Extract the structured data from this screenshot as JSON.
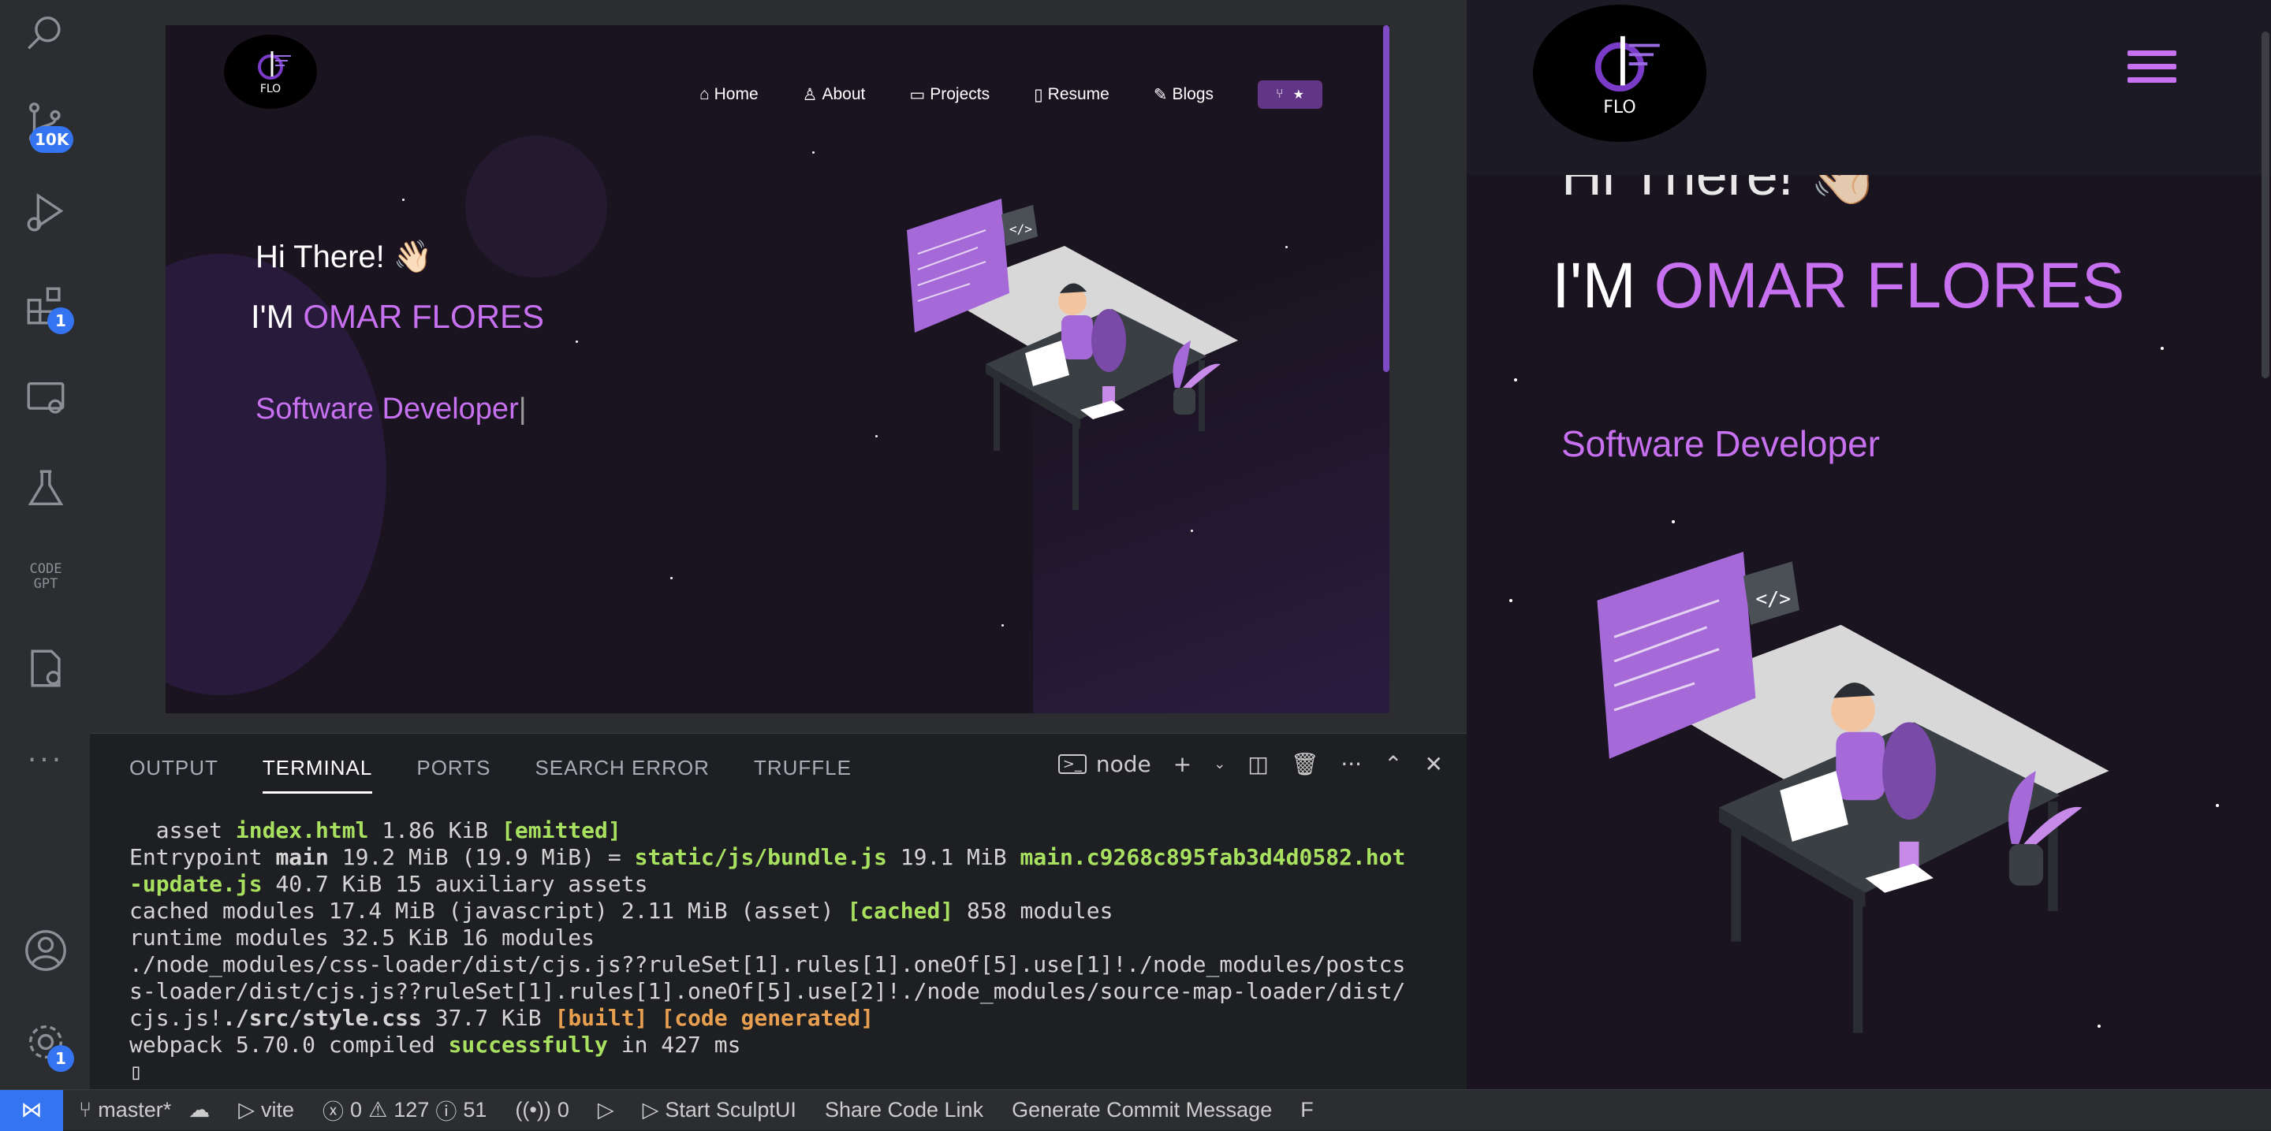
{
  "activity": {
    "scm_badge": "10K",
    "ext_badge": "1",
    "settings_badge": "1",
    "icons": [
      "search-icon",
      "source-control-icon",
      "run-debug-icon",
      "extensions-icon",
      "remote-explorer-icon",
      "testing-icon",
      "codegpt-icon",
      "docker-icon",
      "more-icon",
      "account-icon",
      "settings-icon"
    ],
    "codegpt_text_1": "CODE",
    "codegpt_text_2": "GPT"
  },
  "site": {
    "logo_text": "FLO",
    "nav": [
      "Home",
      "About",
      "Projects",
      "Resume",
      "Blogs"
    ],
    "greeting": "Hi There! 👋🏻",
    "im": "I'M ",
    "name": "OMAR FLORES",
    "role": "Software Developer",
    "cursor": "|"
  },
  "panel": {
    "tabs": [
      "OUTPUT",
      "TERMINAL",
      "PORTS",
      "SEARCH ERROR",
      "TRUFFLE"
    ],
    "active_tab": "TERMINAL",
    "terminal_name": "node"
  },
  "terminal": {
    "l1a": "  asset ",
    "l1b": "index.html",
    "l1c": " 1.86 KiB ",
    "l1d": "[emitted]",
    "l2a": "Entrypoint ",
    "l2b": "main",
    "l2c": " 19.2 MiB (19.9 MiB) = ",
    "l2d": "static/js/bundle.js",
    "l2e": " 19.1 MiB ",
    "l2f": "main.c9268c895fab3d4d0582.hot",
    "l3a": "-update.js",
    "l3b": " 40.7 KiB 15 auxiliary assets",
    "l4a": "cached modules 17.4 MiB (javascript) 2.11 MiB (asset) ",
    "l4b": "[cached]",
    "l4c": " 858 modules",
    "l5": "runtime modules 32.5 KiB 16 modules",
    "l6": "./node_modules/css-loader/dist/cjs.js??ruleSet[1].rules[1].oneOf[5].use[1]!./node_modules/postcs",
    "l7": "s-loader/dist/cjs.js??ruleSet[1].rules[1].oneOf[5].use[2]!./node_modules/source-map-loader/dist/",
    "l8a": "cjs.js!",
    "l8b": "./src/style.css",
    "l8c": " 37.7 KiB ",
    "l8d": "[built]",
    "l8e": " ",
    "l8f": "[code generated]",
    "l9a": "webpack 5.70.0 compiled ",
    "l9b": "successfully",
    "l9c": " in 427 ms",
    "prompt": "▯"
  },
  "status": {
    "branch": "master*",
    "vite": "vite",
    "errors": "0",
    "warnings": "127",
    "info": "51",
    "ports": "0",
    "sculpt": "Start SculptUI",
    "share": "Share Code Link",
    "commit": "Generate Commit Message",
    "extra": "F"
  }
}
